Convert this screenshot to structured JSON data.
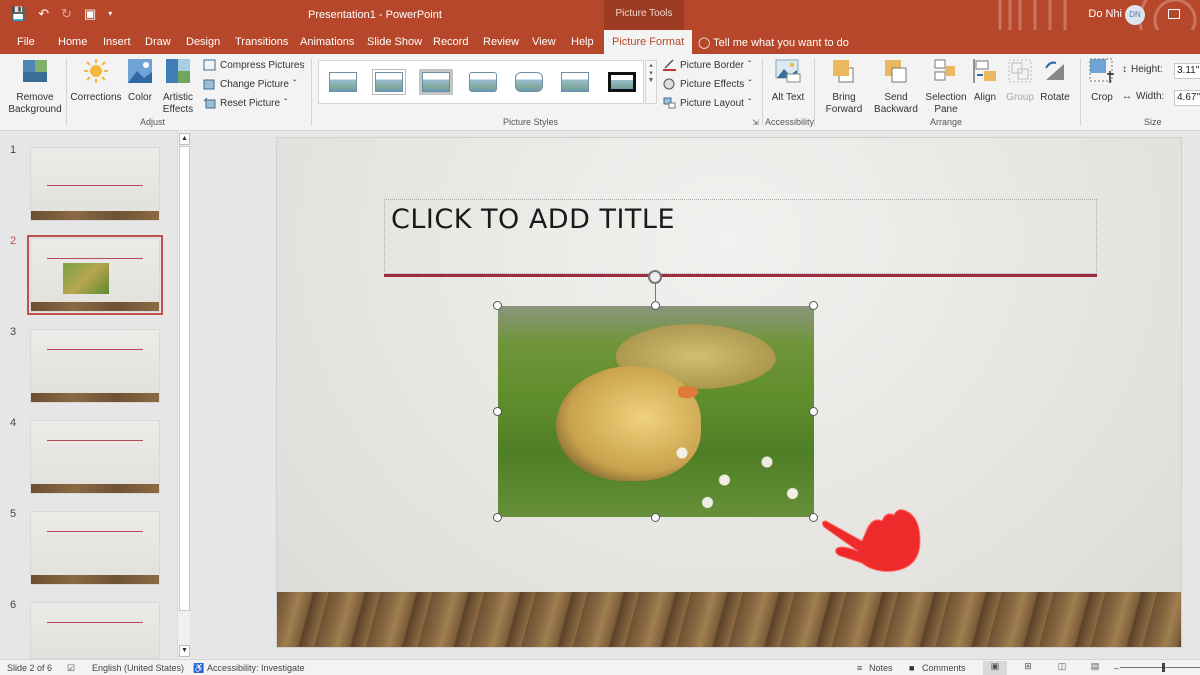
{
  "titlebar": {
    "doc_title": "Presentation1  -  PowerPoint",
    "context_tools": "Picture Tools",
    "user_name": "Do Nhi",
    "user_initials": "DN",
    "qat": [
      "save-icon",
      "undo-icon",
      "redo-icon",
      "present-from-start-icon",
      "customize-qat-icon"
    ]
  },
  "tabs": [
    "File",
    "Home",
    "Insert",
    "Draw",
    "Design",
    "Transitions",
    "Animations",
    "Slide Show",
    "Record",
    "Review",
    "View",
    "Help",
    "Picture Format"
  ],
  "active_tab": "Picture Format",
  "tell_me": "Tell me what you want to do",
  "ribbon": {
    "adjust": {
      "label": "Adjust",
      "remove_background": "Remove Background",
      "corrections": "Corrections",
      "color": "Color",
      "artistic_effects": "Artistic Effects",
      "compress": "Compress Pictures",
      "change": "Change Picture",
      "reset": "Reset Picture"
    },
    "styles": {
      "label": "Picture Styles",
      "border": "Picture Border",
      "effects": "Picture Effects",
      "layout": "Picture Layout",
      "gallery_count": 7
    },
    "accessibility": {
      "label": "Accessibility",
      "alt_text": "Alt Text"
    },
    "arrange": {
      "label": "Arrange",
      "bring_forward": "Bring Forward",
      "send_backward": "Send Backward",
      "selection_pane": "Selection Pane",
      "align": "Align",
      "group": "Group",
      "rotate": "Rotate"
    },
    "size": {
      "label": "Size",
      "crop": "Crop",
      "height_label": "Height:",
      "height_value": "3.11\"",
      "width_label": "Width:",
      "width_value": "4.67\""
    }
  },
  "thumbnails": [
    {
      "num": "1",
      "has_picture": false
    },
    {
      "num": "2",
      "has_picture": true,
      "selected": true
    },
    {
      "num": "3",
      "has_picture": false
    },
    {
      "num": "4",
      "has_picture": false
    },
    {
      "num": "5",
      "has_picture": false
    },
    {
      "num": "6",
      "has_picture": false
    }
  ],
  "slide": {
    "title_placeholder": "CLICK TO ADD TITLE",
    "image_alt": "Two yellow ducklings in grass with daisies"
  },
  "statusbar": {
    "slide_info": "Slide 2 of 6",
    "language": "English (United States)",
    "accessibility": "Accessibility: Investigate",
    "notes": "Notes",
    "comments": "Comments"
  }
}
